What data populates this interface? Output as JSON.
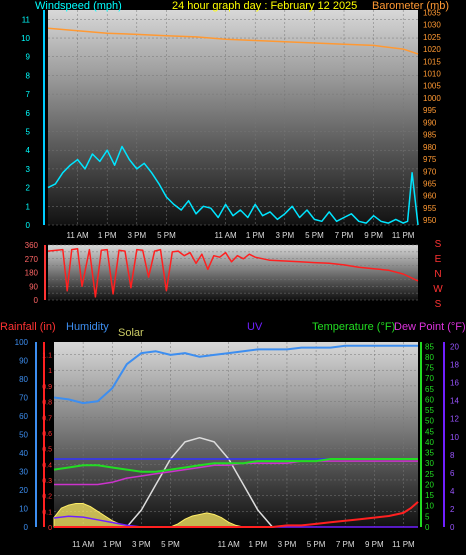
{
  "header": {
    "windspeed_label": "Windspeed (mph)",
    "title": "24 hour graph day : February 12 2025",
    "barometer_label": "Barometer (mb)"
  },
  "lower_header": {
    "rainfall_label": "Rainfall (in)",
    "humidity_label": "Humidity",
    "solar_label": "Solar",
    "uv_label": "UV",
    "temperature_label": "Temperature (°F)",
    "dewpoint_label": "Dew Point (°F)"
  },
  "colors": {
    "windspeed": "#00e5ff",
    "barometer": "#ff9933",
    "direction": "#ff2020",
    "humidity": "#3d8ef0",
    "rain": "#ff2020",
    "solar": "#ffee66",
    "uv": "#7020ff",
    "temperature": "#22dd22",
    "dewpoint": "#cc33cc",
    "sun": "#dddddd"
  },
  "x_ticks": [
    "11 AM",
    "1 PM",
    "3 PM",
    "5 PM",
    "11 AM",
    "1 PM",
    "3 PM",
    "5 PM",
    "7 PM",
    "9 PM",
    "11 PM"
  ],
  "direction_labels": [
    "S",
    "E",
    "N",
    "W",
    "S"
  ],
  "chart_data": [
    {
      "id": "wind_baro",
      "type": "line",
      "title": "24 hour graph day : February 12 2025",
      "x_range": [
        0,
        25
      ],
      "left_axis": {
        "label": "Windspeed (mph)",
        "ylim": [
          0,
          11.5
        ],
        "ticks": [
          0,
          1,
          2,
          3,
          4,
          5,
          6,
          7,
          8,
          9,
          10,
          11
        ]
      },
      "right_axis": {
        "label": "Barometer (mb)",
        "ylim": [
          948,
          1036
        ],
        "ticks": [
          950,
          955,
          960,
          965,
          970,
          975,
          980,
          985,
          990,
          995,
          1000,
          1005,
          1010,
          1015,
          1020,
          1025,
          1030,
          1035
        ]
      },
      "series": [
        {
          "name": "Windspeed (mph)",
          "axis": "left",
          "x": [
            0,
            0.5,
            1,
            1.5,
            2,
            2.5,
            3,
            3.5,
            4,
            4.5,
            5,
            5.5,
            6,
            6.5,
            7,
            7.5,
            8,
            8.5,
            9,
            9.5,
            10,
            10.5,
            11,
            11.5,
            12,
            12.5,
            13,
            13.5,
            14,
            14.5,
            15,
            15.5,
            16,
            16.5,
            17,
            17.5,
            18,
            18.5,
            19,
            19.5,
            20,
            20.5,
            21,
            21.5,
            22,
            22.5,
            23,
            23.5,
            24,
            24.3,
            24.6,
            25
          ],
          "values": [
            2,
            2.2,
            2.8,
            3.2,
            3.5,
            3,
            3.8,
            3.4,
            4,
            3.2,
            4.2,
            3.5,
            3,
            3.3,
            2.8,
            2.2,
            1.5,
            1.1,
            0.8,
            1.3,
            0.6,
            1,
            0.9,
            0.4,
            1.1,
            0.5,
            0.8,
            0.4,
            1.1,
            0.5,
            0.7,
            0.3,
            0.6,
            1,
            0.4,
            0.8,
            0.3,
            0.2,
            0.7,
            0.2,
            0.4,
            0.6,
            0.2,
            0.1,
            0.5,
            0.2,
            0.1,
            0.3,
            0.1,
            0.2,
            2.8,
            0
          ]
        },
        {
          "name": "Barometer (mb)",
          "axis": "right",
          "x": [
            0,
            2,
            4,
            6,
            8,
            10,
            12,
            14,
            16,
            18,
            20,
            22,
            24,
            25
          ],
          "values": [
            1028.5,
            1027.5,
            1026.5,
            1026,
            1025.5,
            1025,
            1024,
            1023.5,
            1023,
            1022.5,
            1022,
            1021.5,
            1020,
            1018
          ]
        }
      ]
    },
    {
      "id": "wind_direction",
      "type": "line",
      "x_range": [
        0,
        25
      ],
      "left_axis": {
        "ylim": [
          0,
          360
        ],
        "ticks": [
          0,
          45,
          90,
          135,
          180,
          225,
          270,
          315,
          360
        ]
      },
      "series": [
        {
          "name": "Wind direction",
          "x": [
            0,
            1,
            1.3,
            1.6,
            2,
            2.3,
            2.8,
            3.2,
            3.6,
            4,
            4.4,
            4.8,
            5.2,
            5.6,
            6,
            6.4,
            6.8,
            7.2,
            7.6,
            8,
            8.4,
            8.8,
            9.2,
            9.6,
            10,
            10.4,
            10.8,
            11.2,
            11.6,
            12,
            12.4,
            12.8,
            13.2,
            13.6,
            14,
            15,
            16,
            17,
            18,
            19,
            20,
            21,
            22,
            23,
            24,
            25
          ],
          "values": [
            320,
            330,
            60,
            330,
            335,
            90,
            330,
            20,
            325,
            330,
            40,
            325,
            320,
            80,
            330,
            325,
            150,
            320,
            330,
            60,
            315,
            320,
            290,
            310,
            240,
            300,
            200,
            290,
            280,
            310,
            250,
            290,
            270,
            300,
            280,
            260,
            255,
            250,
            245,
            240,
            230,
            215,
            205,
            195,
            170,
            125
          ]
        }
      ]
    },
    {
      "id": "weather_multi",
      "type": "line",
      "x_range": [
        0,
        25
      ],
      "axes": {
        "rainfall": {
          "label": "Rainfall (in)",
          "ylim": [
            0,
            1.18
          ],
          "ticks": [
            0,
            0.1,
            0.2,
            0.3,
            0.4,
            0.5,
            0.6,
            0.7,
            0.8,
            0.9,
            1,
            1.1
          ]
        },
        "humidity": {
          "label": "Humidity",
          "ylim": [
            0,
            100
          ],
          "ticks": [
            0,
            10,
            20,
            30,
            40,
            50,
            60,
            70,
            80,
            90,
            100
          ]
        },
        "temperature": {
          "label": "Temperature (°F)",
          "ylim": [
            0,
            87
          ],
          "ticks": [
            0,
            5,
            10,
            15,
            20,
            25,
            30,
            35,
            40,
            45,
            50,
            55,
            60,
            65,
            70,
            75,
            80,
            85
          ]
        },
        "uv": {
          "label": "UV",
          "ylim": [
            0,
            20.5
          ],
          "ticks": [
            0,
            2,
            4,
            6,
            8,
            10,
            12,
            14,
            16,
            18,
            20
          ]
        }
      },
      "series": [
        {
          "name": "Humidity",
          "axis": "humidity",
          "x": [
            0,
            1,
            2,
            3,
            4,
            5,
            6,
            7,
            8,
            9,
            10,
            11,
            12,
            13,
            14,
            15,
            16,
            17,
            18,
            19,
            20,
            21,
            22,
            23,
            24,
            25
          ],
          "values": [
            70,
            69,
            67,
            68,
            75,
            88,
            94,
            95,
            93,
            94,
            92,
            93,
            94,
            95,
            96,
            96,
            96,
            97,
            97,
            97,
            98,
            98,
            98,
            98,
            98,
            98
          ]
        },
        {
          "name": "Temperature (°F)",
          "axis": "temperature",
          "x": [
            0,
            1,
            2,
            3,
            4,
            5,
            6,
            7,
            8,
            9,
            10,
            11,
            12,
            13,
            14,
            15,
            16,
            17,
            18,
            19,
            20,
            21,
            22,
            23,
            24,
            25
          ],
          "values": [
            27,
            28,
            29,
            29,
            28,
            27,
            26,
            26,
            27,
            28,
            29,
            30,
            30,
            30,
            31,
            31,
            31,
            31,
            31,
            32,
            32,
            32,
            32,
            32,
            32,
            32
          ]
        },
        {
          "name": "Dew Point (°F)",
          "axis": "temperature",
          "x": [
            0,
            1,
            2,
            3,
            4,
            5,
            6,
            7,
            8,
            9,
            10,
            11,
            12,
            13,
            14,
            15,
            16,
            17,
            18,
            19,
            20,
            21,
            22,
            23,
            24,
            25
          ],
          "values": [
            20,
            20,
            20,
            20,
            21,
            23,
            24,
            25,
            26,
            27,
            28,
            29,
            29,
            30,
            30,
            30,
            30,
            31,
            31,
            31,
            31,
            31,
            31,
            31,
            31,
            31
          ]
        },
        {
          "name": "Solar",
          "axis": "rainfall",
          "x": [
            0,
            0.5,
            1,
            1.5,
            2,
            2.5,
            3,
            3.5,
            4,
            4.5,
            5,
            5.5,
            6,
            6.5,
            7,
            7.5,
            8,
            8.5,
            9,
            9.5,
            10,
            10.5,
            11,
            11.5,
            12,
            12.5,
            13,
            13.5,
            14,
            14.5,
            15,
            25
          ],
          "values": [
            0.06,
            0.12,
            0.14,
            0.15,
            0.15,
            0.13,
            0.1,
            0.07,
            0.04,
            0.02,
            0.01,
            0,
            0,
            0,
            0,
            0,
            0,
            0.02,
            0.05,
            0.07,
            0.08,
            0.09,
            0.08,
            0.06,
            0.03,
            0.01,
            0,
            0,
            0,
            0,
            0,
            0
          ]
        },
        {
          "name": "UV",
          "axis": "uv",
          "x": [
            0,
            1,
            2,
            3,
            4,
            5,
            6,
            25
          ],
          "values": [
            1,
            1.2,
            1.1,
            0.8,
            0.5,
            0.2,
            0,
            0
          ]
        },
        {
          "name": "Rainfall (in)",
          "axis": "rainfall",
          "x": [
            0,
            5,
            10,
            15,
            16,
            17,
            18,
            19,
            20,
            21,
            22,
            23,
            24,
            24.5,
            25
          ],
          "values": [
            0,
            0,
            0,
            0,
            0.01,
            0.01,
            0.02,
            0.03,
            0.04,
            0.05,
            0.06,
            0.07,
            0.09,
            0.12,
            0.16
          ]
        },
        {
          "name": "Sun elevation",
          "axis": "temperature",
          "x": [
            5,
            6,
            7,
            8,
            9,
            10,
            11,
            12,
            13,
            14,
            15
          ],
          "values": [
            0,
            8,
            20,
            32,
            40,
            42,
            40,
            32,
            20,
            8,
            0
          ]
        }
      ]
    }
  ]
}
